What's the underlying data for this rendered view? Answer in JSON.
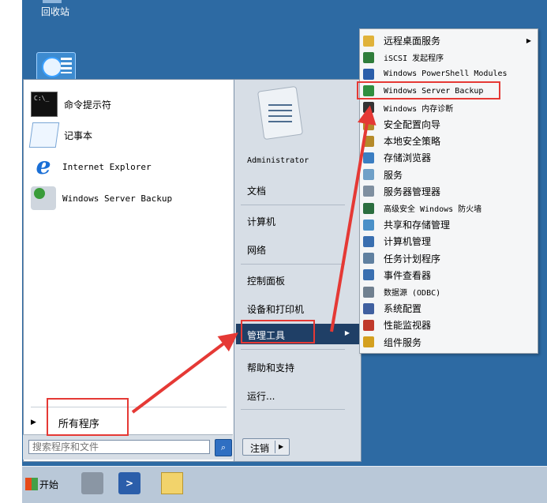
{
  "desktop": {
    "recycle_bin_label": "回收站"
  },
  "start_menu": {
    "pinned_programs": [
      {
        "label": "命令提示符",
        "icon": "command-prompt-icon"
      },
      {
        "label": "记事本",
        "icon": "notepad-icon"
      },
      {
        "label": "Internet Explorer",
        "icon": "internet-explorer-icon"
      },
      {
        "label": "Windows Server Backup",
        "icon": "windows-server-backup-icon"
      }
    ],
    "all_programs_label": "所有程序",
    "search_placeholder": "搜索程序和文件",
    "right_pane": {
      "user": "Administrator",
      "documents": "文档",
      "computer": "计算机",
      "network": "网络",
      "control_panel": "控制面板",
      "devices_printers": "设备和打印机",
      "admin_tools": "管理工具",
      "help_support": "帮助和支持",
      "run": "运行..."
    },
    "logoff_label": "注销"
  },
  "admin_tools_submenu": [
    {
      "label": "远程桌面服务",
      "icon": "folder-icon",
      "has_submenu": true
    },
    {
      "label": "iSCSI 发起程序",
      "icon": "iscsi-icon"
    },
    {
      "label": "Windows PowerShell Modules",
      "icon": "powershell-icon"
    },
    {
      "label": "Windows Server Backup",
      "icon": "windows-server-backup-icon"
    },
    {
      "label": "Windows 内存诊断",
      "icon": "memory-diagnostic-icon"
    },
    {
      "label": "安全配置向导",
      "icon": "security-wizard-icon"
    },
    {
      "label": "本地安全策略",
      "icon": "local-security-policy-icon"
    },
    {
      "label": "存储浏览器",
      "icon": "storage-explorer-icon"
    },
    {
      "label": "服务",
      "icon": "services-icon"
    },
    {
      "label": "服务器管理器",
      "icon": "server-manager-icon"
    },
    {
      "label": "高级安全 Windows 防火墙",
      "icon": "firewall-icon"
    },
    {
      "label": "共享和存储管理",
      "icon": "share-storage-icon"
    },
    {
      "label": "计算机管理",
      "icon": "computer-management-icon"
    },
    {
      "label": "任务计划程序",
      "icon": "task-scheduler-icon"
    },
    {
      "label": "事件查看器",
      "icon": "event-viewer-icon"
    },
    {
      "label": "数据源 (ODBC)",
      "icon": "odbc-icon"
    },
    {
      "label": "系统配置",
      "icon": "system-config-icon"
    },
    {
      "label": "性能监视器",
      "icon": "performance-monitor-icon"
    },
    {
      "label": "组件服务",
      "icon": "component-services-icon"
    }
  ],
  "taskbar": {
    "start_label": "开始"
  },
  "colors": {
    "desktop_blue": "#2d6aa3",
    "highlight_navy": "#1f3f66",
    "annotation_red": "#e53935"
  }
}
